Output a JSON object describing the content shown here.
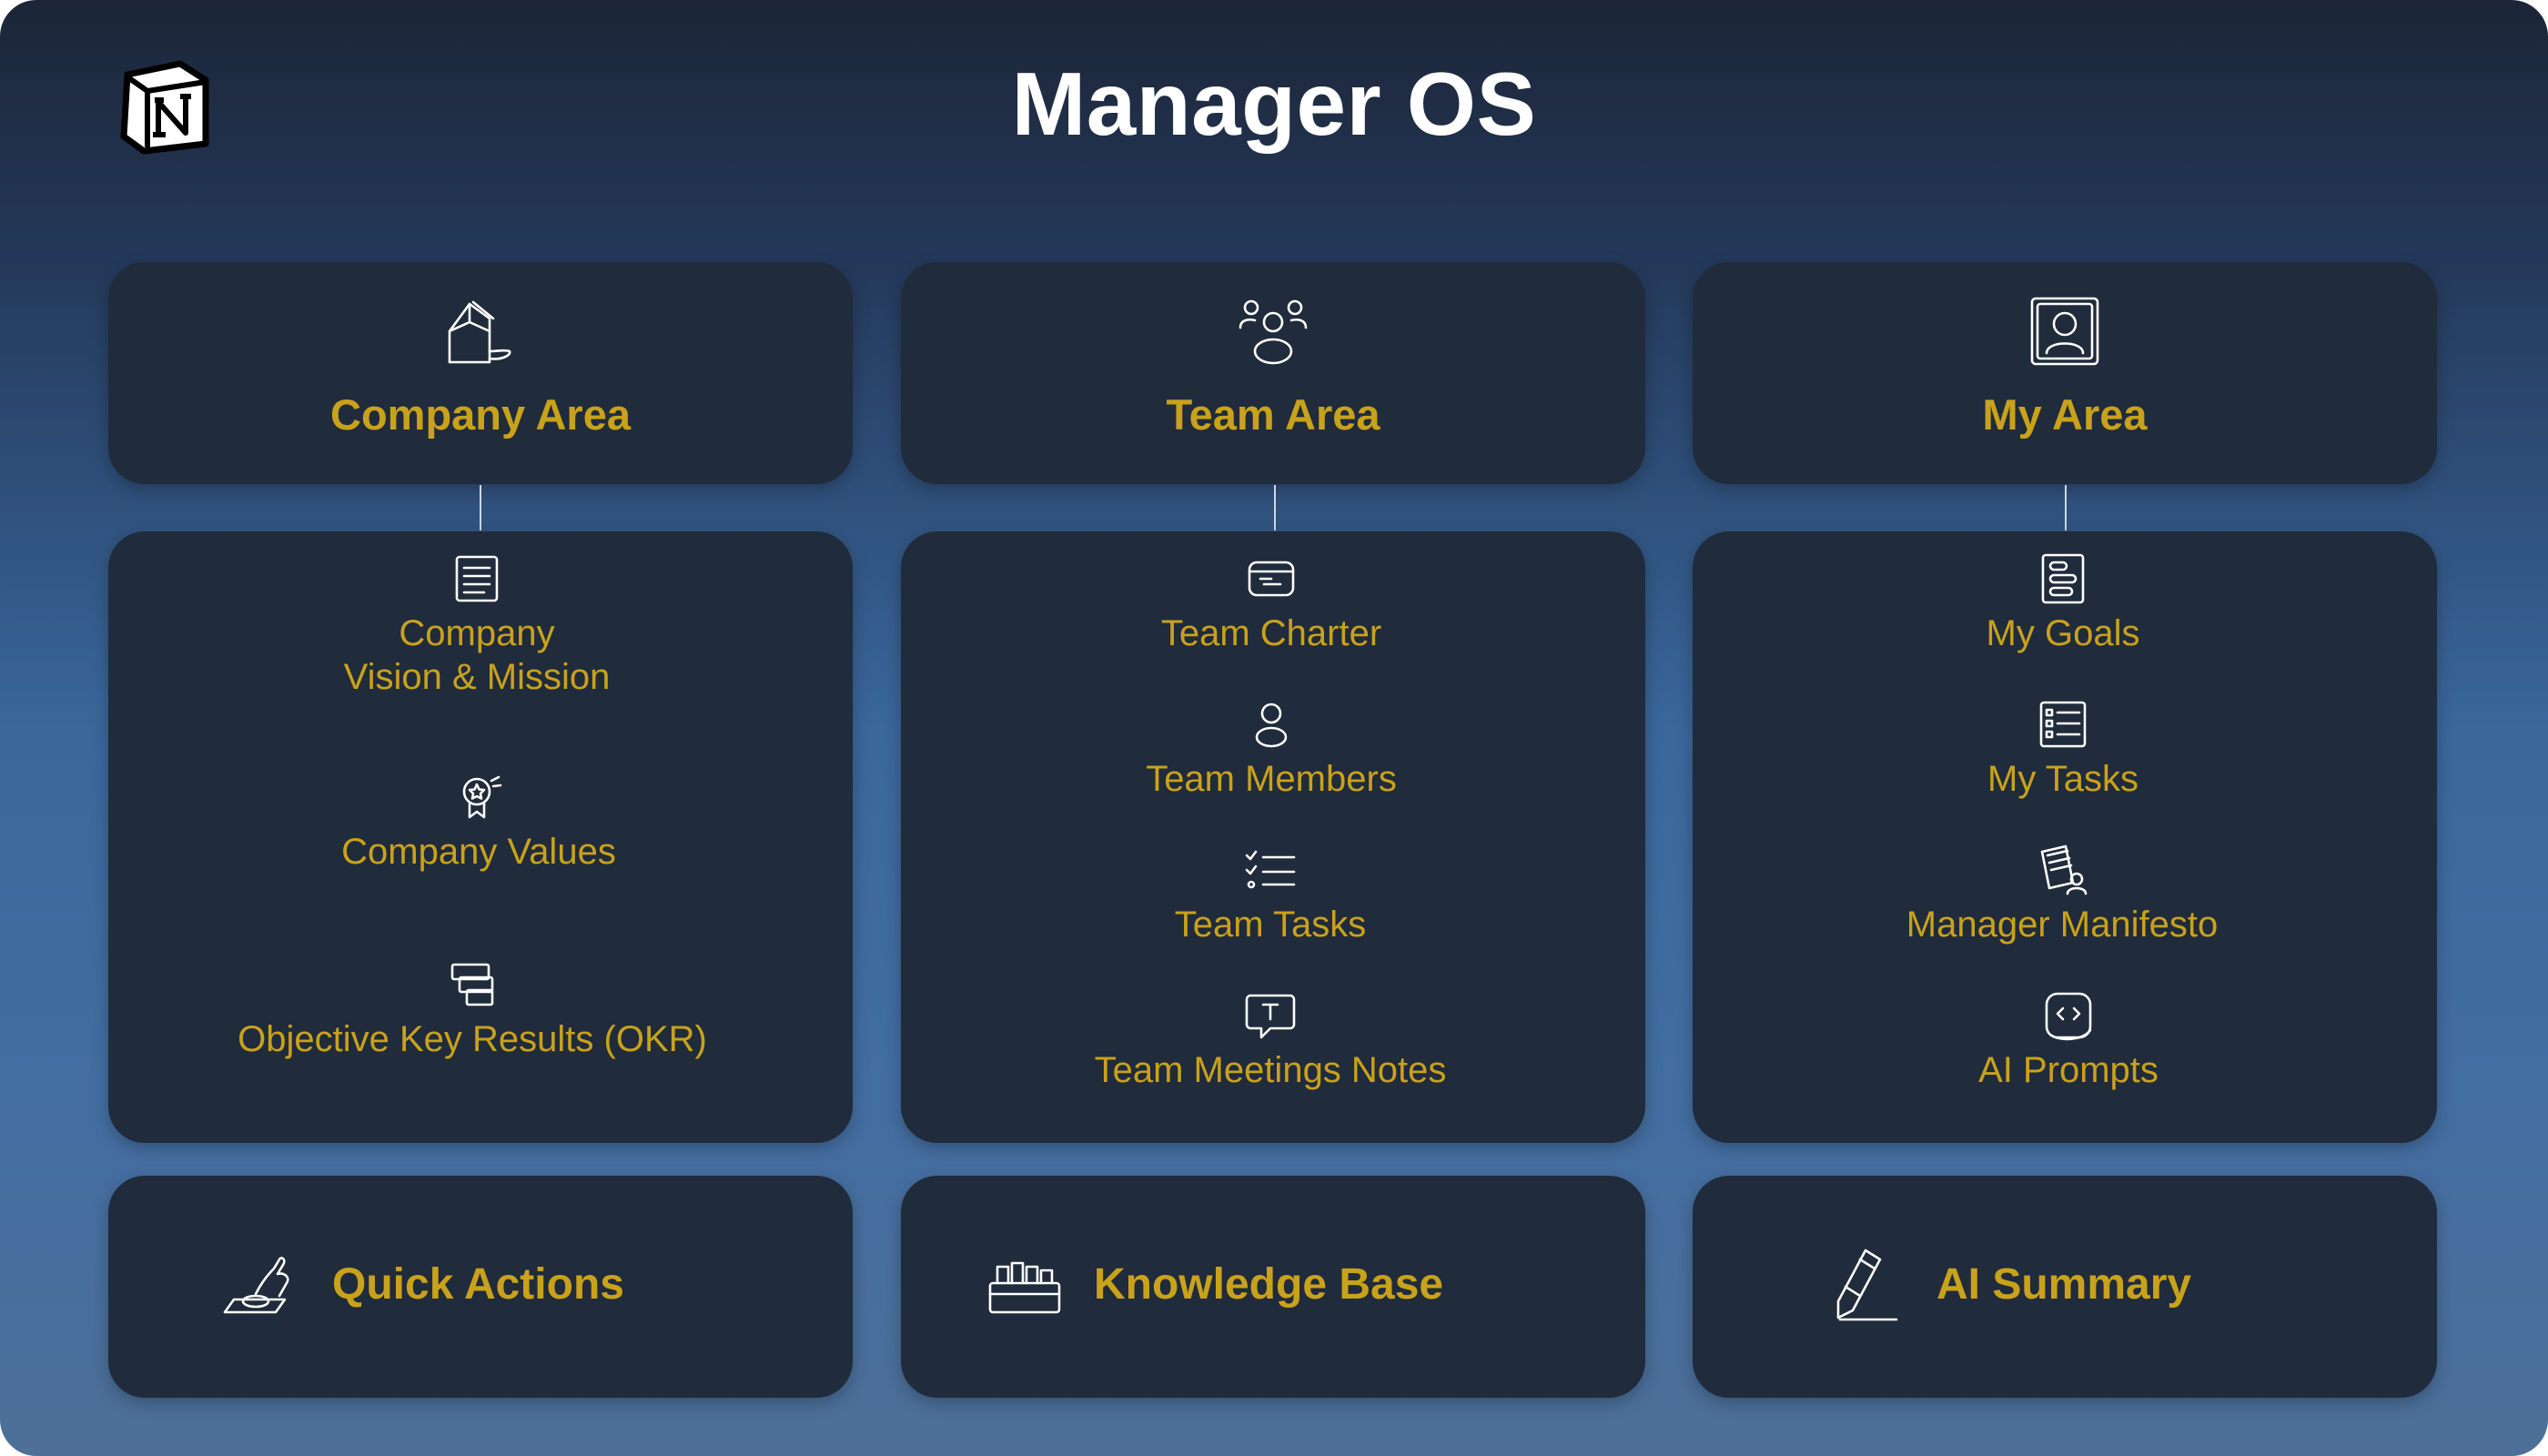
{
  "title": "Manager OS",
  "logo_icon": "notion-logo-icon",
  "colors": {
    "accent": "#c9a21b",
    "card": "#202b3b",
    "text": "#ffffff"
  },
  "columns": [
    {
      "header": {
        "label": "Company Area",
        "icon": "house-icon"
      },
      "items": [
        {
          "label_line1": "Company",
          "label_line2": "Vision & Mission",
          "icon": "document-icon"
        },
        {
          "label": "Company Values",
          "icon": "award-badge-icon"
        },
        {
          "label": "Objective Key Results (OKR)",
          "icon": "stacked-cards-icon"
        }
      ],
      "footer": {
        "label": "Quick Actions",
        "icon": "hand-button-icon"
      }
    },
    {
      "header": {
        "label": "Team Area",
        "icon": "group-people-icon"
      },
      "items": [
        {
          "label": "Team Charter",
          "icon": "charter-board-icon"
        },
        {
          "label": "Team Members",
          "icon": "person-icon"
        },
        {
          "label": "Team Tasks",
          "icon": "checklist-icon"
        },
        {
          "label": "Team Meetings Notes",
          "icon": "chat-text-icon"
        }
      ],
      "footer": {
        "label": "Knowledge Base",
        "icon": "file-folders-icon"
      }
    },
    {
      "header": {
        "label": "My Area",
        "icon": "profile-frame-icon"
      },
      "items": [
        {
          "label": "My Goals",
          "icon": "goals-list-icon"
        },
        {
          "label": "My Tasks",
          "icon": "task-list-icon"
        },
        {
          "label": "Manager Manifesto",
          "icon": "notepad-person-icon"
        },
        {
          "label": "AI Prompts",
          "icon": "code-brackets-icon"
        }
      ],
      "footer": {
        "label": "AI Summary",
        "icon": "pencil-icon"
      }
    }
  ]
}
